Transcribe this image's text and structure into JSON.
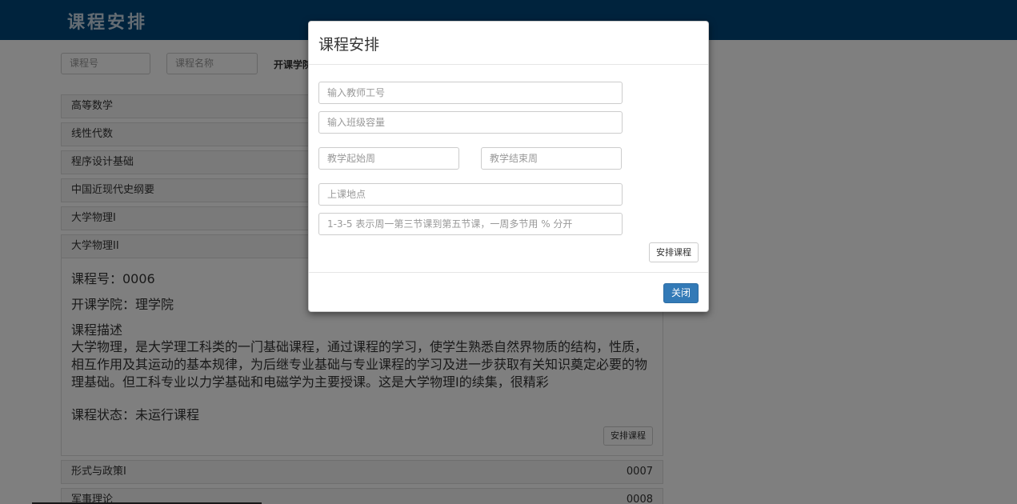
{
  "header": {
    "brand": "课程安排"
  },
  "search": {
    "course_no_placeholder": "课程号",
    "course_name_placeholder": "课程名称",
    "college_label": "开课学院"
  },
  "courses": [
    {
      "name": "高等数学",
      "code": ""
    },
    {
      "name": "线性代数",
      "code": ""
    },
    {
      "name": "程序设计基础",
      "code": ""
    },
    {
      "name": "中国近现代史纲要",
      "code": ""
    },
    {
      "name": "大学物理I",
      "code": ""
    },
    {
      "name": "大学物理II",
      "code": ""
    },
    {
      "name": "形式与政策I",
      "code": "0007"
    },
    {
      "name": "军事理论",
      "code": "0008"
    }
  ],
  "detail": {
    "course_no": "课程号：0006",
    "college": "开课学院：理学院",
    "desc_title": "课程描述",
    "desc": "大学物理，是大学理工科类的一门基础课程，通过课程的学习，使学生熟悉自然界物质的结构，性质，相互作用及其运动的基本规律，为后继专业基础与专业课程的学习及进一步获取有关知识奠定必要的物理基础。但工科专业以力学基础和电磁学为主要授课。这是大学物理I的续集，很精彩",
    "status": "课程状态：未运行课程",
    "arrange_button": "安排课程"
  },
  "modal": {
    "title": "课程安排",
    "teacher_placeholder": "输入教师工号",
    "capacity_placeholder": "输入班级容量",
    "week_start_placeholder": "教学起始周",
    "week_end_placeholder": "教学结束周",
    "location_placeholder": "上课地点",
    "schedule_placeholder": "1-3-5 表示周一第三节课到第五节课，一周多节用 % 分开",
    "arrange_button": "安排课程",
    "close_button": "关闭"
  },
  "colors": {
    "header_bg": "#00477a",
    "primary_button": "#337ab7"
  }
}
